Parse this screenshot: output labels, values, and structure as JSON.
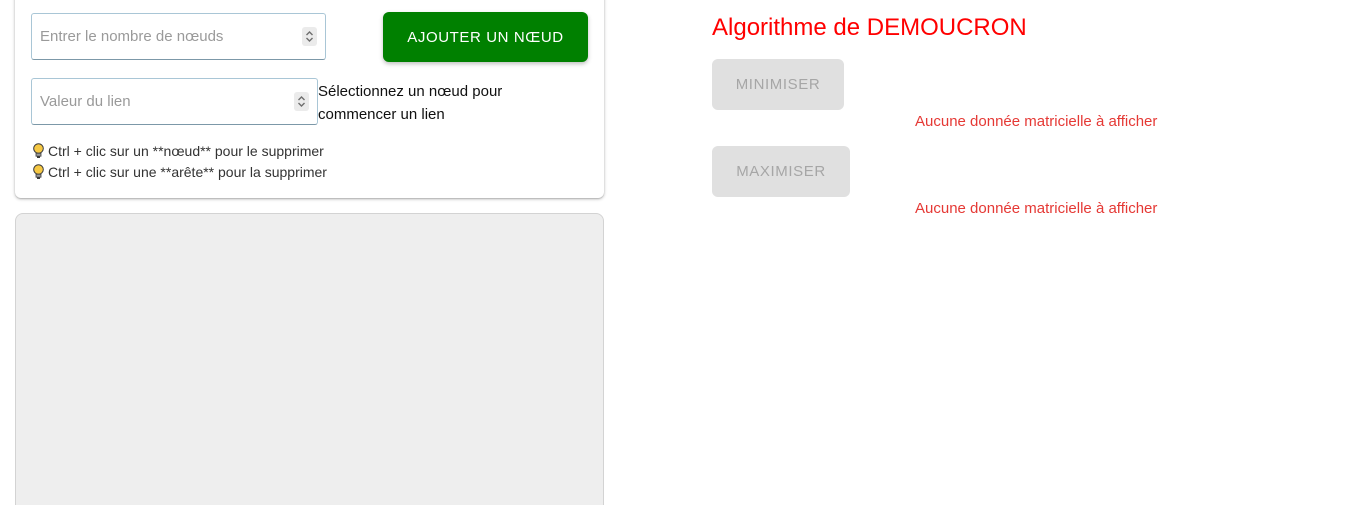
{
  "controls": {
    "node_count_placeholder": "Entrer le nombre de nœuds",
    "add_node_label": "AJOUTER UN NŒUD",
    "link_value_placeholder": "Valeur du lien",
    "select_node_message": "Sélectionnez un nœud pour commencer un lien",
    "tips": [
      "Ctrl + clic sur un **nœud** pour le supprimer",
      "Ctrl + clic sur une **arête** pour la supprimer"
    ]
  },
  "algorithm": {
    "title": "Algorithme de DEMOUCRON",
    "minimize_label": "MINIMISER",
    "maximize_label": "MAXIMISER",
    "minimize_empty_message": "Aucune donnée matricielle à afficher",
    "maximize_empty_message": "Aucune donnée matricielle à afficher"
  },
  "colors": {
    "add_button_bg": "#008000",
    "title_color": "#ff0000",
    "empty_message_color": "#e53935",
    "disabled_button_bg": "#e0e0e0",
    "canvas_bg": "#eeeeee"
  },
  "icons": {
    "spinner": "spinner-arrows-icon",
    "tip": "lightbulb-icon"
  }
}
